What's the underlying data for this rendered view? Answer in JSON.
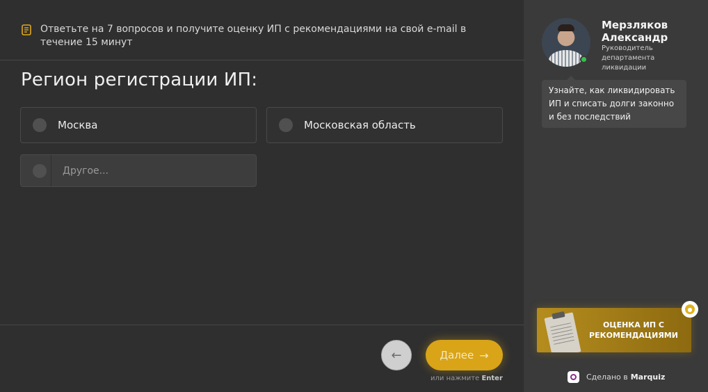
{
  "header": {
    "info_text": "Ответьте на 7 вопросов и получите оценку ИП с рекомендациями на свой e-mail в течение 15 минут",
    "icon": "note-icon"
  },
  "question": {
    "title": "Регион регистрации ИП:",
    "options": [
      {
        "label": "Москва",
        "selected": false
      },
      {
        "label": "Московская область",
        "selected": false
      }
    ],
    "other": {
      "placeholder": "Другое...",
      "value": ""
    }
  },
  "navigation": {
    "back_icon": "arrow-left-icon",
    "next_label": "Далее",
    "next_icon": "arrow-right-icon",
    "hint_prefix": "или нажмите",
    "hint_key": "Enter",
    "accent_color": "#d9a417"
  },
  "manager": {
    "name": "Мерзляков Александр",
    "role": "Руководитель департамента ликвидации",
    "online": true,
    "message": "Узнайте, как ликвидировать ИП и списать долги законно и без последствий"
  },
  "bonus": {
    "title": "ОЦЕНКА ИП С РЕКОМЕНДАЦИЯМИ",
    "icon": "lock-icon"
  },
  "footer": {
    "made_prefix": "Сделано в",
    "brand": "Marquiz"
  }
}
